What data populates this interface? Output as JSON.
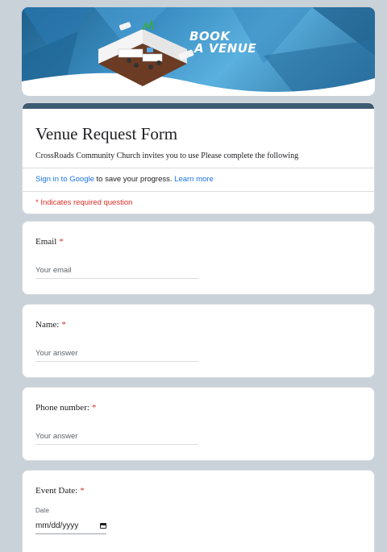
{
  "banner": {
    "line1": "BOOK",
    "line2": "A VENUE"
  },
  "form": {
    "title": "Venue Request Form",
    "description": "CrossRoads Community Church invites you to use Please complete the following",
    "signin_link": "Sign in to Google",
    "signin_text": " to save your progress. ",
    "learn_more": "Learn more",
    "required_note": "* Indicates required question"
  },
  "questions": [
    {
      "label": "Email",
      "required": "*",
      "placeholder": "Your email"
    },
    {
      "label": "Name:",
      "required": "*",
      "placeholder": "Your answer"
    },
    {
      "label": "Phone number:",
      "required": "*",
      "placeholder": "Your answer"
    },
    {
      "label": "Event Date:",
      "required": "*",
      "sublabel": "Date",
      "placeholder": "mm/dd/yyyy"
    }
  ],
  "colors": {
    "accent_bar": "#3d5a73",
    "link": "#1a73e8",
    "required": "#d93025",
    "background": "#c9d1d9"
  },
  "icons": [
    "calendar-icon"
  ]
}
